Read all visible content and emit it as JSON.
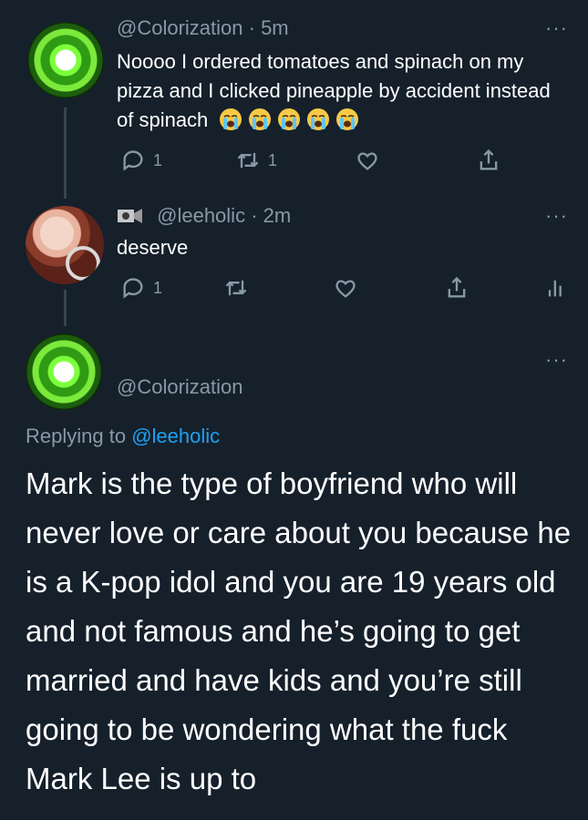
{
  "tweet1": {
    "handle": "@Colorization",
    "time": "· 5m",
    "text": "Noooo I ordered tomatoes and spinach on my pizza and I clicked pineapple by accident instead of spinach",
    "emoji_icons": [
      "loudly-crying-face-icon",
      "loudly-crying-face-icon",
      "loudly-crying-face-icon",
      "loudly-crying-face-icon",
      "loudly-crying-face-icon"
    ],
    "reply_count": "1",
    "retweet_count": "1",
    "more": "···"
  },
  "tweet2": {
    "handle": "@leeholic",
    "time": "· 2m",
    "text": "deserve",
    "reply_count": "1",
    "more": "···"
  },
  "tweet3": {
    "handle": "@Colorization",
    "replying_prefix": "Replying to",
    "replying_handle": "@leeholic",
    "text": "Mark is the type of boyfriend who will never love or care about you because he is a K-pop idol and you are 19 years old and not famous and he’s going to get married and have kids and you’re still going to be wondering what the fuck Mark Lee is up to",
    "more": "···"
  },
  "colors": {
    "background": "#15202b",
    "muted": "#8899a6",
    "link": "#1da1f2",
    "thread_line": "#38444d"
  }
}
